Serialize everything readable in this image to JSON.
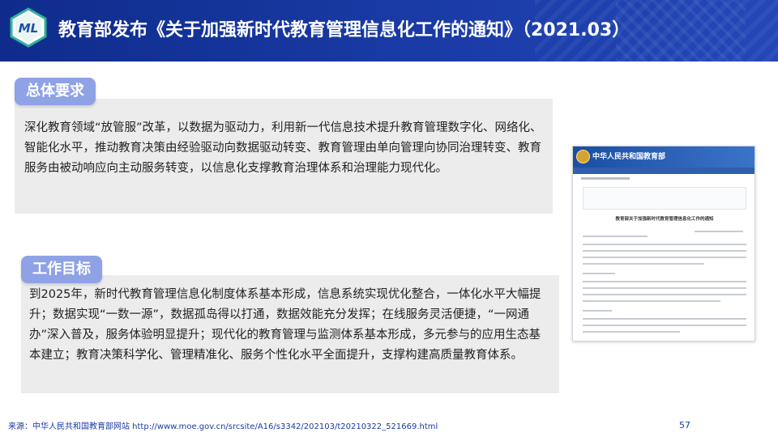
{
  "header": {
    "title": "教育部发布《关于加强新时代教育管理信息化工作的通知》（2021.03）",
    "logo_text": "ML"
  },
  "sections": [
    {
      "label": "总体要求",
      "body": "深化教育领域“放管服”改革，以数据为驱动力，利用新一代信息技术提升教育管理数字化、网络化、智能化水平，推动教育决策由经验驱动向数据驱动转变、教育管理由单向管理向协同治理转变、教育服务由被动响应向主动服务转变，以信息化支撑教育治理体系和治理能力现代化。"
    },
    {
      "label": "工作目标",
      "body": "到2025年，新时代教育管理信息化制度体系基本形成，信息系统实现优化整合，一体化水平大幅提升；数据实现“一数一源”，数据孤岛得以打通，数据效能充分发挥；在线服务灵活便捷，“一网通办”深入普及，服务体验明显提升；现代化的教育管理与监测体系基本形成，多元参与的应用生态基本建立；教育决策科学化、管理精准化、服务个性化水平全面提升，支撑构建高质量教育体系。"
    }
  ],
  "document_preview": {
    "site_name": "中华人民共和国教育部",
    "doc_title": "教育部关于加强新时代教育管理信息化工作的通知"
  },
  "footer": {
    "source": "来源：中华人民共和国教育部网站 http://www.moe.gov.cn/srcsite/A16/s3342/202103/t20210322_521669.html",
    "page_number": "57"
  },
  "colors": {
    "header_blue": "#1a3ba6",
    "pill": "#8fa2e6",
    "box_bg": "#ececec"
  }
}
